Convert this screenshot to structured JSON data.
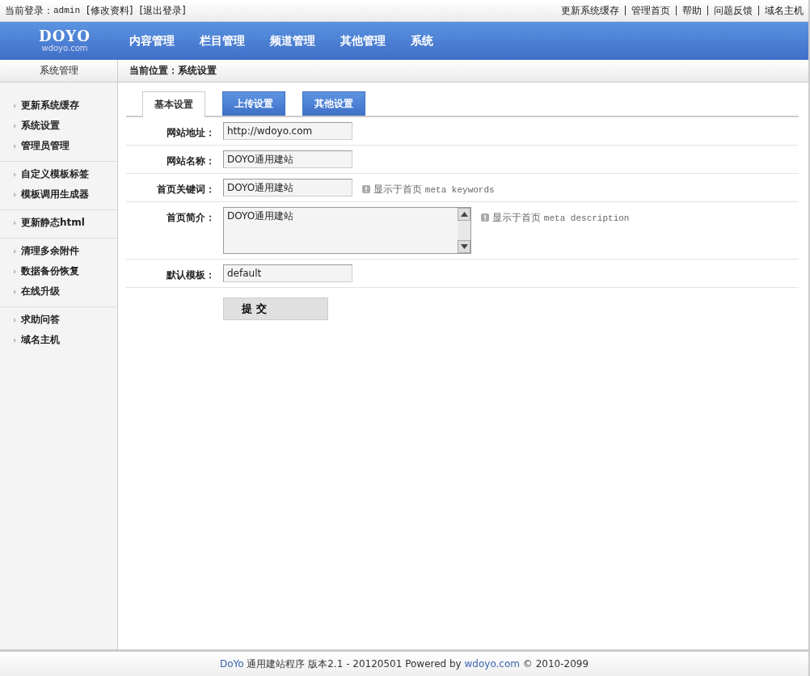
{
  "top_bar": {
    "login_label": "当前登录：",
    "user": "admin",
    "links": [
      "[修改资料]",
      "[退出登录]"
    ],
    "right_links": [
      "更新系统缓存",
      "管理首页",
      "帮助",
      "问题反馈",
      "域名主机"
    ]
  },
  "header": {
    "logo": {
      "name": "DOYO",
      "domain": "wdoyo.com"
    },
    "nav": [
      "内容管理",
      "栏目管理",
      "频道管理",
      "其他管理",
      "系统"
    ]
  },
  "sidebar": {
    "title": "系统管理",
    "groups": [
      [
        "更新系统缓存",
        "系统设置",
        "管理员管理"
      ],
      [
        "自定义模板标签",
        "模板调用生成器"
      ],
      [
        "更新静态html"
      ],
      [
        "清理多余附件",
        "数据备份恢复",
        "在线升级"
      ],
      [
        "求助问答",
        "域名主机"
      ]
    ]
  },
  "breadcrumb": "当前位置：系统设置",
  "tabs": [
    {
      "label": "基本设置",
      "selected": true
    },
    {
      "label": "上传设置",
      "selected": false
    },
    {
      "label": "其他设置",
      "selected": false
    }
  ],
  "fields": [
    {
      "kind": "input",
      "label": "网站地址：",
      "value": "http://wdoyo.com"
    },
    {
      "kind": "input",
      "label": "网站名称：",
      "value": "DOYO通用建站"
    },
    {
      "kind": "input",
      "label": "首页关键词：",
      "value": "DOYO通用建站",
      "hint": "显示于首页",
      "hint_code": "meta keywords"
    },
    {
      "kind": "textarea",
      "label": "首页简介：",
      "value": "DOYO通用建站",
      "hint": "显示于首页",
      "hint_code": "meta description"
    },
    {
      "kind": "input",
      "label": "默认模板：",
      "value": "default"
    }
  ],
  "submit": "提 交",
  "footer": {
    "brand": "DoYo",
    "text": "通用建站程序  版本2.1 - 20120501 Powered by",
    "link": "wdoyo.com",
    "tail": "© 2010-2099"
  }
}
